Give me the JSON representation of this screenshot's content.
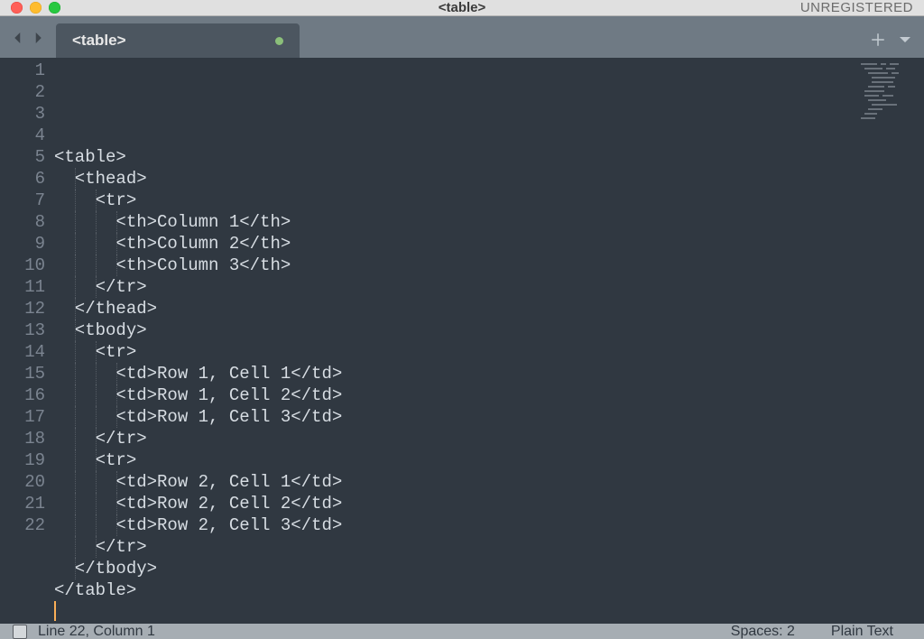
{
  "window": {
    "title": "<table>",
    "registration": "UNREGISTERED"
  },
  "tab": {
    "title": "<table>"
  },
  "gutter": {
    "lines": [
      "1",
      "2",
      "3",
      "4",
      "5",
      "6",
      "7",
      "8",
      "9",
      "10",
      "11",
      "12",
      "13",
      "14",
      "15",
      "16",
      "17",
      "18",
      "19",
      "20",
      "21",
      "22"
    ]
  },
  "code": {
    "lines": [
      {
        "indent": 0,
        "text": "<table>"
      },
      {
        "indent": 1,
        "text": "<thead>"
      },
      {
        "indent": 2,
        "text": "<tr>"
      },
      {
        "indent": 3,
        "text": "<th>Column 1</th>"
      },
      {
        "indent": 3,
        "text": "<th>Column 2</th>"
      },
      {
        "indent": 3,
        "text": "<th>Column 3</th>"
      },
      {
        "indent": 2,
        "text": "</tr>"
      },
      {
        "indent": 1,
        "text": "</thead>"
      },
      {
        "indent": 1,
        "text": "<tbody>"
      },
      {
        "indent": 2,
        "text": "<tr>"
      },
      {
        "indent": 3,
        "text": "<td>Row 1, Cell 1</td>"
      },
      {
        "indent": 3,
        "text": "<td>Row 1, Cell 2</td>"
      },
      {
        "indent": 3,
        "text": "<td>Row 1, Cell 3</td>"
      },
      {
        "indent": 2,
        "text": "</tr>"
      },
      {
        "indent": 2,
        "text": "<tr>"
      },
      {
        "indent": 3,
        "text": "<td>Row 2, Cell 1</td>"
      },
      {
        "indent": 3,
        "text": "<td>Row 2, Cell 2</td>"
      },
      {
        "indent": 3,
        "text": "<td>Row 2, Cell 3</td>"
      },
      {
        "indent": 2,
        "text": "</tr>"
      },
      {
        "indent": 1,
        "text": "</tbody>"
      },
      {
        "indent": 0,
        "text": "</table>"
      },
      {
        "indent": 0,
        "text": "",
        "cursor": true
      }
    ]
  },
  "status": {
    "position": "Line 22, Column 1",
    "spaces": "Spaces: 2",
    "syntax": "Plain Text"
  }
}
